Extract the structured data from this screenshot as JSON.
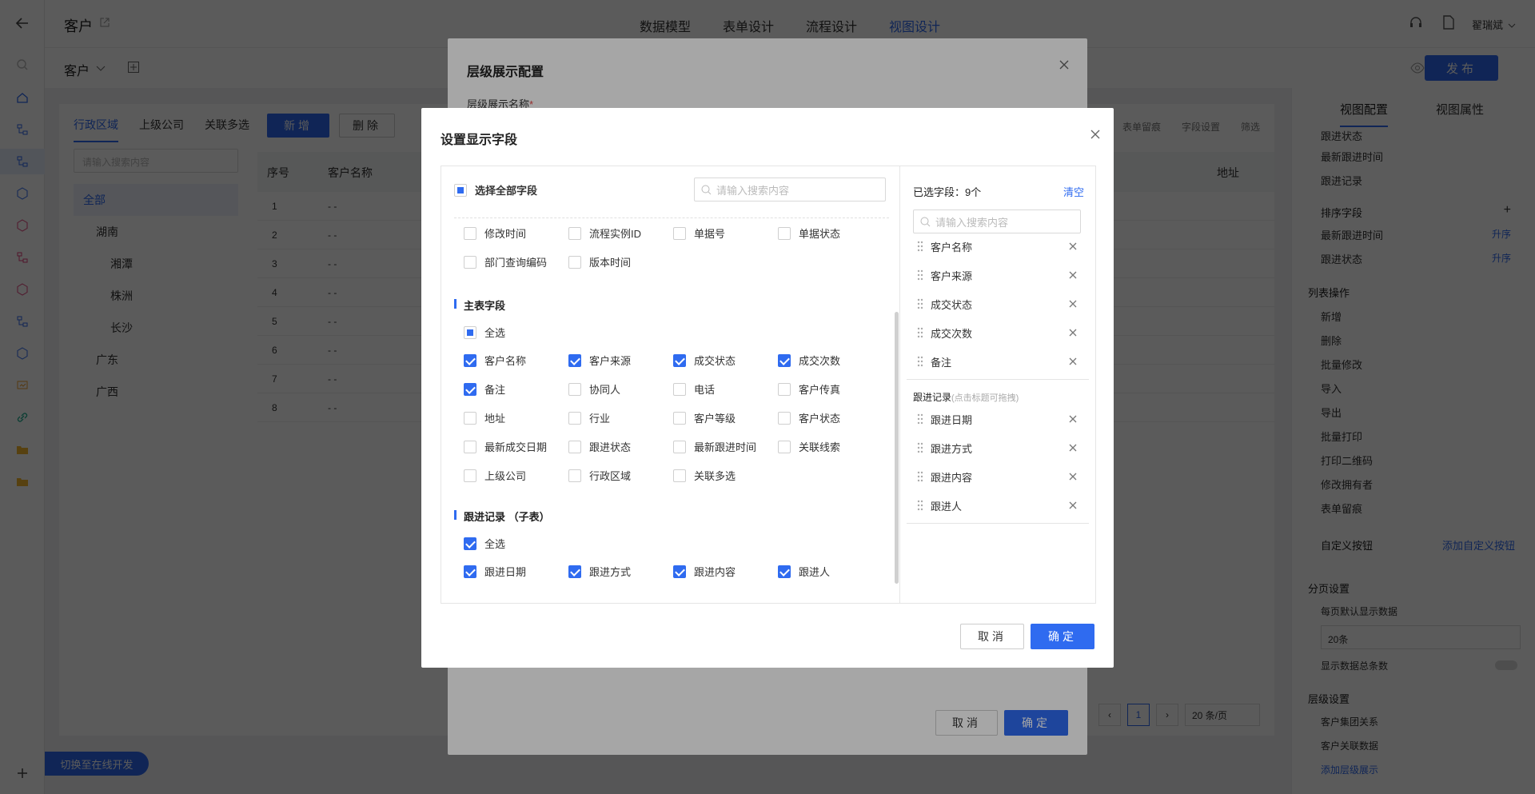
{
  "header": {
    "title": "客户",
    "tabs": [
      "数据模型",
      "表单设计",
      "流程设计",
      "视图设计"
    ],
    "user": "翟瑞斌"
  },
  "subbar": {
    "name": "客户",
    "publish": "发布"
  },
  "content": {
    "tabs": [
      "行政区域",
      "上级公司",
      "关联多选"
    ],
    "search_placeholder": "请输入搜索内容",
    "tree": [
      "全部",
      "湖南",
      "湘潭",
      "株洲",
      "长沙",
      "广东",
      "广西"
    ],
    "btn_new": "新增",
    "btn_delete": "删除",
    "col_index": "序号",
    "col_name": "客户名称",
    "col_address": "地址",
    "rows": [
      "1",
      "2",
      "3",
      "4",
      "5",
      "6",
      "7",
      "8"
    ],
    "empty_cell": "- -",
    "toolbar": [
      "表单留痕",
      "字段设置",
      "筛选"
    ],
    "pager": {
      "current": "1",
      "size": "20 条/页"
    }
  },
  "rightpanel": {
    "tabs": [
      "视图配置",
      "视图属性"
    ],
    "top_items": [
      "跟进状态",
      "最新跟进时间",
      "跟进记录"
    ],
    "sort_title": "排序字段",
    "sort_items": [
      {
        "name": "最新跟进时间",
        "order": "升序"
      },
      {
        "name": "跟进状态",
        "order": "升序"
      }
    ],
    "list_ops_title": "列表操作",
    "list_ops": [
      "新增",
      "删除",
      "批量修改",
      "导入",
      "导出",
      "批量打印",
      "打印二维码",
      "修改拥有者",
      "表单留痕"
    ],
    "custom_btn_title": "自定义按钮",
    "custom_btn_link": "添加自定义按钮",
    "paging_title": "分页设置",
    "paging_default_label": "每页默认显示数据",
    "paging_default_value": "20条",
    "show_total_label": "显示数据总条数",
    "level_title": "层级设置",
    "level_items": [
      "客户集团关系",
      "客户关联数据"
    ],
    "level_link": "添加层级展示"
  },
  "online_dev": "切换至在线开发",
  "dialog1": {
    "title": "层级展示配置",
    "name_label": "层级展示名称",
    "cancel": "取消",
    "ok": "确定"
  },
  "dialog2": {
    "title": "设置显示字段",
    "select_all": "选择全部字段",
    "search_placeholder": "请输入搜索内容",
    "system_fields": [
      {
        "label": "修改时间",
        "checked": false
      },
      {
        "label": "流程实例ID",
        "checked": false
      },
      {
        "label": "单据号",
        "checked": false
      },
      {
        "label": "单据状态",
        "checked": false
      },
      {
        "label": "部门查询编码",
        "checked": false
      },
      {
        "label": "版本时间",
        "checked": false
      }
    ],
    "main_title": "主表字段",
    "main_all": "全选",
    "main_fields": [
      {
        "label": "客户名称",
        "checked": true
      },
      {
        "label": "客户来源",
        "checked": true
      },
      {
        "label": "成交状态",
        "checked": true
      },
      {
        "label": "成交次数",
        "checked": true
      },
      {
        "label": "备注",
        "checked": true
      },
      {
        "label": "协同人",
        "checked": false
      },
      {
        "label": "电话",
        "checked": false
      },
      {
        "label": "客户传真",
        "checked": false
      },
      {
        "label": "地址",
        "checked": false
      },
      {
        "label": "行业",
        "checked": false
      },
      {
        "label": "客户等级",
        "checked": false
      },
      {
        "label": "客户状态",
        "checked": false
      },
      {
        "label": "最新成交日期",
        "checked": false
      },
      {
        "label": "跟进状态",
        "checked": false
      },
      {
        "label": "最新跟进时间",
        "checked": false
      },
      {
        "label": "关联线索",
        "checked": false
      },
      {
        "label": "上级公司",
        "checked": false
      },
      {
        "label": "行政区域",
        "checked": false
      },
      {
        "label": "关联多选",
        "checked": false
      }
    ],
    "sub_title": "跟进记录 （子表）",
    "sub_all": "全选",
    "sub_fields": [
      {
        "label": "跟进日期",
        "checked": true
      },
      {
        "label": "跟进方式",
        "checked": true
      },
      {
        "label": "跟进内容",
        "checked": true
      },
      {
        "label": "跟进人",
        "checked": true
      }
    ],
    "selected_label": "已选字段：",
    "selected_count": "9个",
    "clear": "清空",
    "selected_main": [
      "客户名称",
      "客户来源",
      "成交状态",
      "成交次数",
      "备注"
    ],
    "selected_sub_title": "跟进记录",
    "selected_sub_hint": "(点击标题可拖拽)",
    "selected_sub": [
      "跟进日期",
      "跟进方式",
      "跟进内容",
      "跟进人"
    ],
    "cancel": "取消",
    "ok": "确定"
  },
  "colors": {
    "accent": "#2f6bf0",
    "required": "#e84a4a"
  }
}
